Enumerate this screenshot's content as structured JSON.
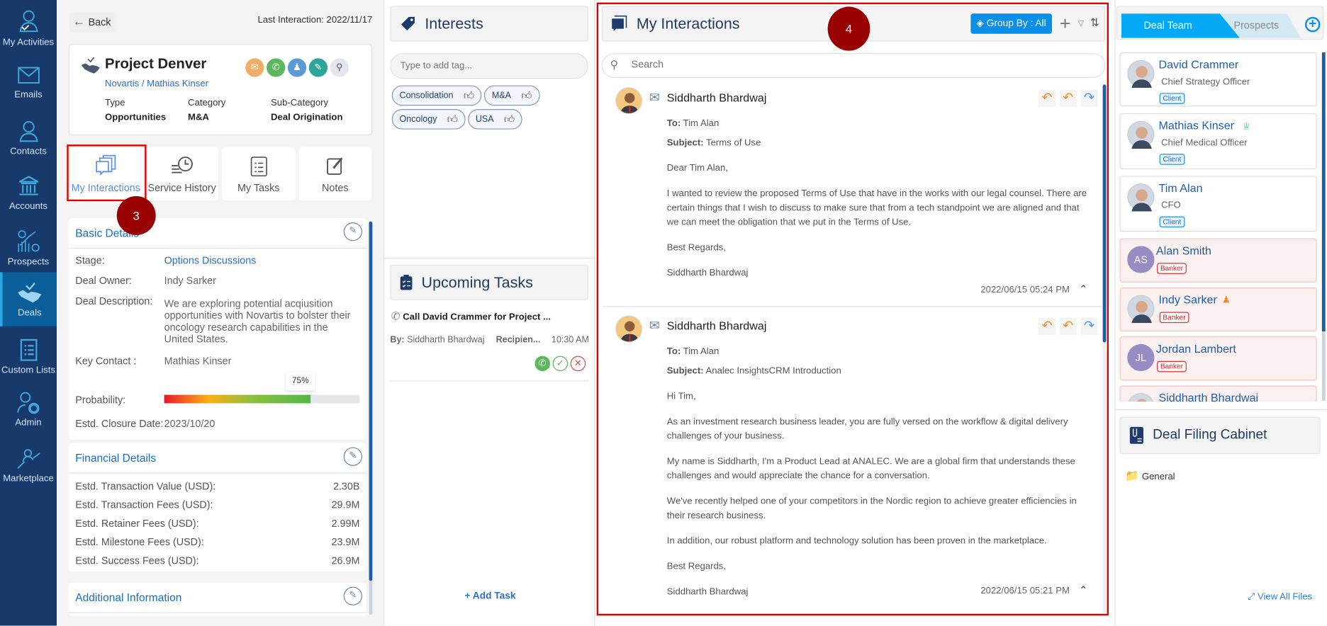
{
  "sidebar": {
    "items": [
      {
        "label": "My Activities",
        "icon": "user-check-icon"
      },
      {
        "label": "Emails",
        "icon": "envelope-icon"
      },
      {
        "label": "Contacts",
        "icon": "user-icon"
      },
      {
        "label": "Accounts",
        "icon": "bank-icon"
      },
      {
        "label": "Prospects",
        "icon": "chart-gear-icon"
      },
      {
        "label": "Deals",
        "icon": "handshake-icon",
        "active": true
      },
      {
        "label": "Custom Lists",
        "icon": "clipboard-list-icon"
      },
      {
        "label": "Admin",
        "icon": "user-gear-icon"
      },
      {
        "label": "Marketplace",
        "icon": "marketplace-icon"
      }
    ]
  },
  "back_label": "Back",
  "last_interaction": "Last Interaction: 2022/11/17",
  "deal": {
    "title": "Project Denver",
    "company": "Novartis",
    "contact": "Mathias Kinser",
    "sep": " / ",
    "type_label": "Type",
    "type": "Opportunities",
    "category_label": "Category",
    "category": "M&A",
    "subcategory_label": "Sub-Category",
    "subcategory": "Deal Origination"
  },
  "tabs": [
    "My Interactions",
    "Service History",
    "My Tasks",
    "Notes"
  ],
  "basic": {
    "title": "Basic Details",
    "stage_label": "Stage:",
    "stage": "Options Discussions",
    "owner_label": "Deal Owner:",
    "owner": "Indy Sarker",
    "desc_label": "Deal Description:",
    "desc": "We are exploring potential acqiusition opportunities with Novartis to bolster their oncology research capabilities in the United States.",
    "key_label": "Key Contact :",
    "key": "Mathias Kinser",
    "prob_label": "Probability:",
    "prob": "75%",
    "prob_value": 75,
    "close_label": "Estd. Closure Date:",
    "close": "2023/10/20"
  },
  "financial": {
    "title": "Financial Details",
    "rows": [
      {
        "k": "Estd. Transaction Value (USD):",
        "v": "2.30B"
      },
      {
        "k": "Estd. Transaction Fees (USD):",
        "v": "29.9M"
      },
      {
        "k": "Estd. Retainer Fees (USD):",
        "v": "2.99M"
      },
      {
        "k": "Estd. Milestone Fees (USD):",
        "v": "23.9M"
      },
      {
        "k": "Estd. Success Fees (USD):",
        "v": "26.9M"
      }
    ]
  },
  "additional": {
    "title": "Additional Information"
  },
  "interests": {
    "title": "Interests",
    "placeholder": "Type to add tag...",
    "tags": [
      "Consolidation",
      "M&A",
      "Oncology",
      "USA"
    ]
  },
  "tasks": {
    "title": "Upcoming Tasks",
    "task": "Call David Crammer for Project ...",
    "by_label": "By:",
    "by": "Siddharth Bhardwaj",
    "recipient": "Recipien...",
    "time": "10:30 AM",
    "add": "+ Add Task"
  },
  "interactions": {
    "title": "My Interactions",
    "group_by": "Group By : All",
    "search_placeholder": "Search",
    "emails": [
      {
        "from": "Siddharth Bhardwaj",
        "to_label": "To:",
        "to": "Tim Alan",
        "subject_label": "Subject:",
        "subject": "Terms of Use",
        "paras": [
          "Dear Tim Alan,",
          "I wanted to review the proposed Terms of Use that have in the works with our legal counsel. There are certain things  that I wish to discuss to make sure that from a tech standpoint we are aligned and that we can meet the obligation that we put in the Terms of Use.",
          "Best Regards,",
          "Siddharth Bhardwaj"
        ],
        "timestamp": "2022/06/15 05:24 PM"
      },
      {
        "from": "Siddharth Bhardwaj",
        "to_label": "To:",
        "to": "Tim Alan",
        "subject_label": "Subject:",
        "subject": "Analec InsightsCRM Introduction",
        "paras": [
          "Hi Tim,",
          "As an investment research business leader, you are fully versed on the workflow & digital delivery challenges of your business.",
          "My name is Siddharth, I'm a Product Lead at ANALEC. We are a global firm that understands these challenges and would appreciate the chance for a conversation.",
          "We've recently helped one of your competitors in the Nordic region to achieve greater efficiencies in their research business.",
          "In addition, our robust platform and technology solution has been proven in the marketplace.",
          "Best Regards,",
          "Siddharth Bhardwaj"
        ],
        "timestamp": "2022/06/15 05:21 PM"
      }
    ]
  },
  "team": {
    "tabs": [
      "Deal Team",
      "Prospects"
    ],
    "members": [
      {
        "name": "David Crammer",
        "title": "Chief Strategy Officer",
        "badge": "Client"
      },
      {
        "name": "Mathias Kinser",
        "title": "Chief Medical Officer",
        "badge": "Client",
        "crown": true
      },
      {
        "name": "Tim Alan",
        "title": "CFO",
        "badge": "Client"
      },
      {
        "name": "Alan Smith",
        "initials": "AS",
        "badge": "Banker"
      },
      {
        "name": "Indy Sarker",
        "badge": "Banker",
        "owner": true
      },
      {
        "name": "Jordan Lambert",
        "initials": "JL",
        "badge": "Banker"
      },
      {
        "name": "Siddharth Bhardwaj"
      }
    ]
  },
  "cabinet": {
    "title": "Deal Filing Cabinet",
    "folder": "General",
    "view_all": "View All Files"
  },
  "markers": [
    "3",
    "4"
  ],
  "colors": {
    "sidebar": "#173a6b",
    "accent": "#0a8fe8",
    "highlight": "#e00000",
    "marker": "#990000"
  }
}
